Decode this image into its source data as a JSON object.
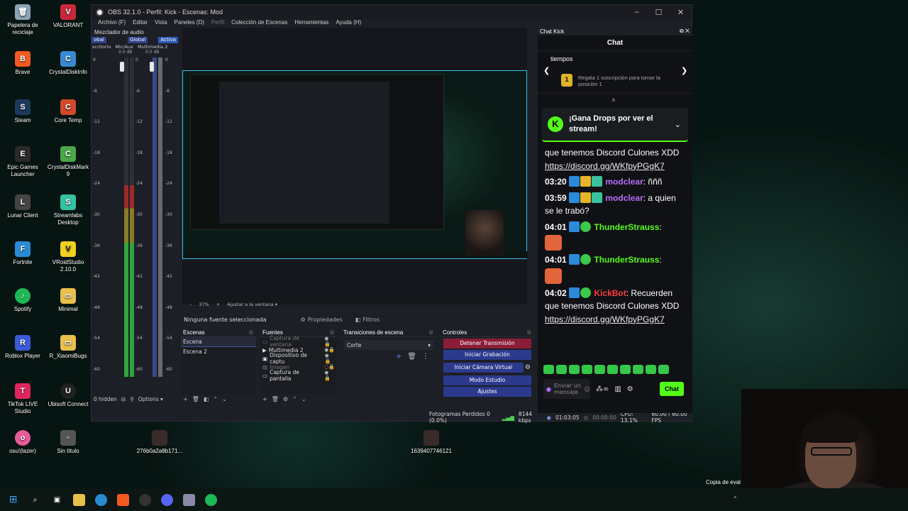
{
  "desktop": {
    "icons_col1": [
      "Papelera de reciclaje",
      "Brave",
      "Steam",
      "Epic Games Launcher",
      "Lunar Client",
      "Fortnite",
      "Spotify",
      "Roblox Player",
      "TikTok LIVE Studio",
      "osu!(lazer)"
    ],
    "icons_col2": [
      "VALORANT",
      "CrystalDiskInfo",
      "Core Temp",
      "CrystalDiskMark 9",
      "Streamlabs Desktop",
      "VRoidStudio 2.10.0",
      "Minimal",
      "R_XiaomiBugs",
      "Ubisoft Connect",
      "Sin título"
    ],
    "file1": "276b0a2a8b171...",
    "file2": "1639407746121",
    "watermark": "Copia de eval"
  },
  "obs": {
    "title": "OBS 32.1.0 - Perfil: Kick - Escenas: Mod",
    "menu": [
      "Archivo (F)",
      "Editar",
      "Vista",
      "Paneles (D)",
      "Perfil",
      "Colección de Escenas",
      "Herramientas",
      "Ayuda (H)"
    ],
    "mixer": {
      "title": "Mezclador de audio",
      "tabs": [
        "obal",
        "Global",
        "Activa"
      ],
      "channels": [
        "scritorio",
        "Mic/Aux",
        "Multimedia 2"
      ],
      "db": [
        "0.0 dB",
        "0.0 dB"
      ],
      "scale": [
        "0",
        "-6",
        "-12",
        "-18",
        "-24",
        "-30",
        "-36",
        "-42",
        "-48",
        "-54",
        "-60"
      ],
      "hidden": "0 hidden",
      "options": "Options"
    },
    "preview": {
      "zoom": "37%",
      "fit": "Ajustar a la ventana"
    },
    "props_bar": {
      "no_source": "Ninguna fuente seleccionada",
      "properties": "Propiedades",
      "filters": "Filtros"
    },
    "scenes": {
      "title": "Escenas",
      "items": [
        "Escena",
        "Escena 2"
      ]
    },
    "sources": {
      "title": "Fuentes",
      "items": [
        "Captura de ventana",
        "Multimedia 2",
        "Dispositivo de captu",
        "Imagen",
        "Captura de pantalla"
      ]
    },
    "transitions": {
      "title": "Transiciones de escena",
      "selected": "Corte"
    },
    "controls": {
      "title": "Controles",
      "stop_stream": "Detener Transmisión",
      "start_record": "Iniciar Grabación",
      "virtual_cam": "Iniciar Cámara Virtual",
      "studio": "Modo Estudio",
      "settings": "Ajustes"
    },
    "status": {
      "dropped": "Fotogramas Perdidos 0 (0.0%)",
      "bitrate": "8144 kbps",
      "live_time": "01:03:05",
      "rec_time": "00:00:00",
      "cpu": "CPU: 13.1%",
      "fps": "60.00 / 60.00 FPS"
    }
  },
  "chat": {
    "dock_title": "Chat Kick",
    "title": "Chat",
    "pinned_top": "tiempos",
    "pinned_badge": "1",
    "pinned_text": "Regala 1 suscripción para tomar la posición 1",
    "drops": "¡Gana Drops por ver el stream!",
    "lines": [
      {
        "text": "que tenemos Discord Culones XDD"
      },
      {
        "link": "https://discord.gg/WKfpyPGgK7"
      }
    ],
    "messages": [
      {
        "time": "03:20",
        "user": "modclear",
        "text": ": ñññ"
      },
      {
        "time": "03:59",
        "user": "modclear",
        "text": ": a quien se le trabó?"
      },
      {
        "time": "04:01",
        "user": "ThunderStrauss",
        "text": ":"
      },
      {
        "time": "04:01",
        "user": "ThunderStrauss",
        "text": ":"
      },
      {
        "time": "04:02",
        "user": "KickBot",
        "text": ": Recuerden que tenemos Discord Culones XDD",
        "link": "https://discord.gg/WKfpyPGgK7"
      }
    ],
    "input_placeholder": "Enviar un mensaje",
    "send": "Chat"
  },
  "colors": {
    "kick_green": "#53fc18",
    "obs_blue": "#2c3a8e",
    "stop_red": "#8b1d38",
    "preview_border": "#3ec0e8"
  }
}
